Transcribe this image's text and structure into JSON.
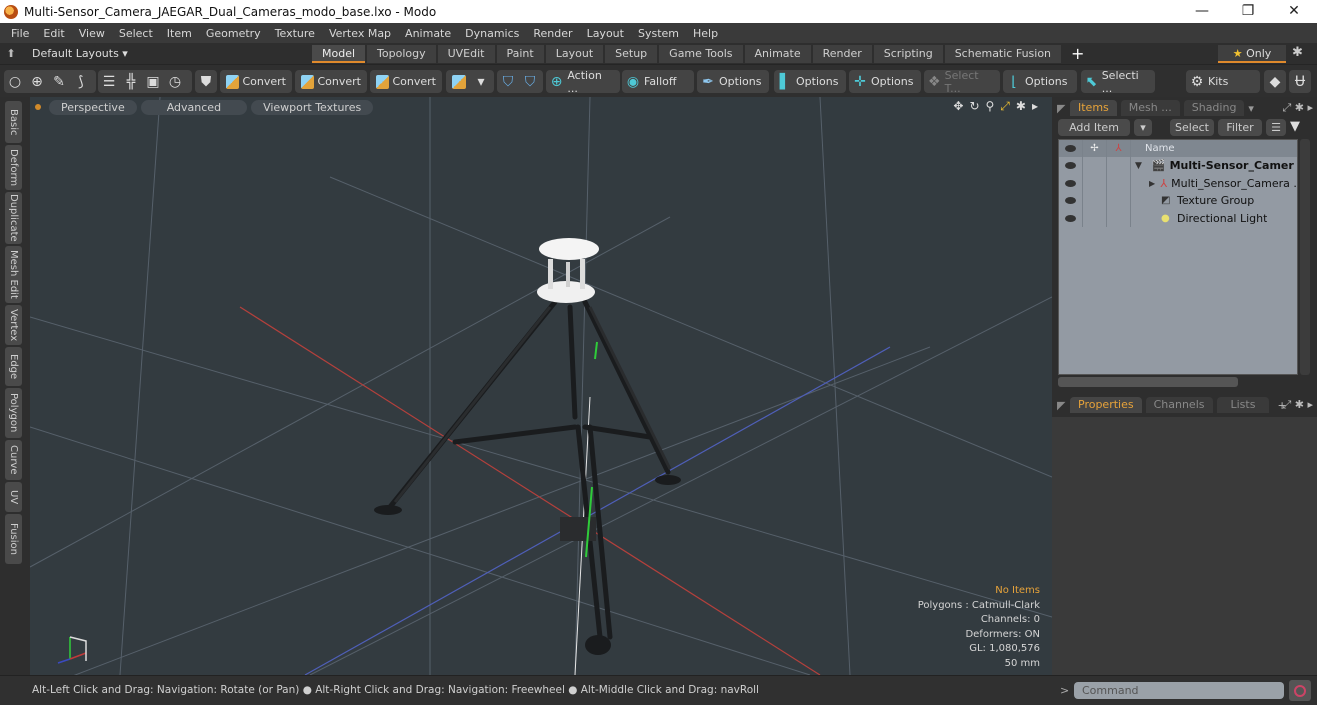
{
  "window": {
    "title": "Multi-Sensor_Camera_JAEGAR_Dual_Cameras_modo_base.lxo - Modo",
    "controls": {
      "minimize": "—",
      "restore": "❐",
      "close": "✕"
    }
  },
  "menu": [
    "File",
    "Edit",
    "View",
    "Select",
    "Item",
    "Geometry",
    "Texture",
    "Vertex Map",
    "Animate",
    "Dynamics",
    "Render",
    "Layout",
    "System",
    "Help"
  ],
  "layoutbar": {
    "layouts_label": "Default Layouts ▾",
    "tabs": [
      {
        "label": "Model",
        "active": true
      },
      {
        "label": "Topology"
      },
      {
        "label": "UVEdit"
      },
      {
        "label": "Paint"
      },
      {
        "label": "Layout"
      },
      {
        "label": "Setup"
      },
      {
        "label": "Game Tools"
      },
      {
        "label": "Animate"
      },
      {
        "label": "Render"
      },
      {
        "label": "Scripting"
      },
      {
        "label": "Schematic Fusion"
      }
    ],
    "add_tab": "+",
    "only_label": "Only",
    "only_star": "★"
  },
  "toolbar": {
    "convert1": "Convert",
    "convert2": "Convert",
    "convert3": "Convert",
    "action": "Action ...",
    "falloff": "Falloff",
    "options1": "Options",
    "options2": "Options",
    "options3": "Options",
    "select_t": "Select T...",
    "options4": "Options",
    "selecti": "Selecti ...",
    "kits": "Kits"
  },
  "left_rail": [
    "Basic",
    "Deform",
    "Duplicate",
    "Mesh Edit",
    "Vertex",
    "Edge",
    "Polygon",
    "Curve",
    "UV",
    "Fusion"
  ],
  "viewport": {
    "view_mode": "Perspective",
    "shading": "Advanced",
    "textures": "Viewport Textures",
    "info": {
      "selection": "No Items",
      "polygons": "Polygons : Catmull-Clark",
      "channels": "Channels: 0",
      "deformers": "Deformers: ON",
      "gl": "GL: 1,080,576",
      "scale": "50 mm"
    }
  },
  "items_panel": {
    "tabs": [
      {
        "label": "Items",
        "active": true
      },
      {
        "label": "Mesh ..."
      },
      {
        "label": "Shading"
      }
    ],
    "add_item": "Add Item",
    "select": "Select",
    "filter": "Filter",
    "name_header": "Name",
    "rows": [
      {
        "name": "Multi-Sensor_Camer ...",
        "bold": true,
        "expander": "▼",
        "icon": "scene-icon"
      },
      {
        "name": "Multi_Sensor_Camera ...",
        "expander": "▶",
        "icon": "locator-icon"
      },
      {
        "name": "Texture Group",
        "icon": "folder-icon"
      },
      {
        "name": "Directional Light",
        "icon": "light-icon"
      }
    ]
  },
  "properties_panel": {
    "tabs": [
      {
        "label": "Properties",
        "active": true
      },
      {
        "label": "Channels"
      },
      {
        "label": "Lists"
      }
    ],
    "add": "+"
  },
  "statusbar": {
    "hint": "Alt-Left Click and Drag: Navigation: Rotate (or Pan) ● Alt-Right Click and Drag: Navigation: Freewheel ● Alt-Middle Click and Drag: navRoll",
    "command_placeholder": "Command",
    "prompt": ">"
  }
}
